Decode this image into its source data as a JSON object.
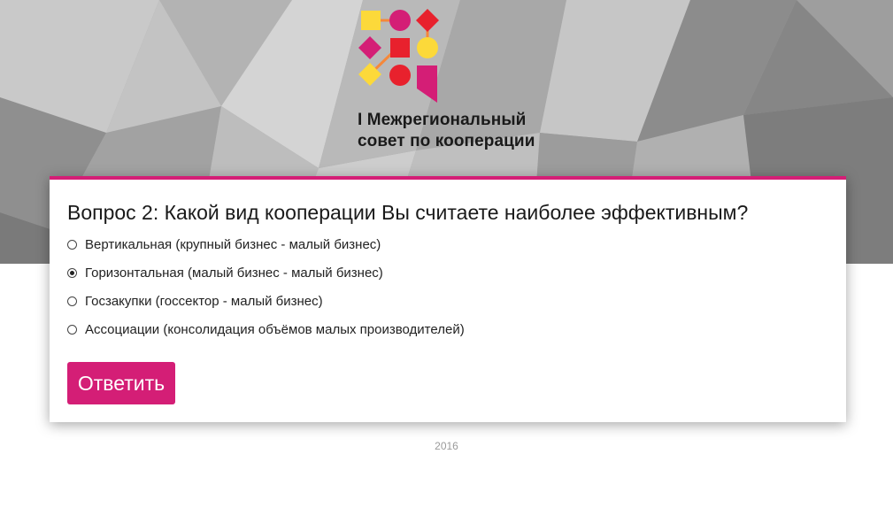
{
  "header": {
    "logo_line1": "I Межрегиональный",
    "logo_line2": "совет по кооперации"
  },
  "poll": {
    "question": "Вопрос 2: Какой вид кооперации Вы считаете наиболее эффективным?",
    "options": [
      {
        "label": "Вертикальная (крупный бизнес - малый бизнес)",
        "selected": false
      },
      {
        "label": "Горизонтальная (малый бизнес - малый бизнес)",
        "selected": true
      },
      {
        "label": "Госзакупки (госсектор - малый бизнес)",
        "selected": false
      },
      {
        "label": "Ассоциации (консолидация объёмов малых производителей)",
        "selected": false
      }
    ],
    "submit_label": "Ответить"
  },
  "footer": {
    "year": "2016"
  },
  "colors": {
    "accent": "#d41e76",
    "logo_yellow": "#fcd93a",
    "logo_magenta": "#d41e76",
    "logo_red": "#e8212d",
    "logo_orange": "#f5883a"
  }
}
